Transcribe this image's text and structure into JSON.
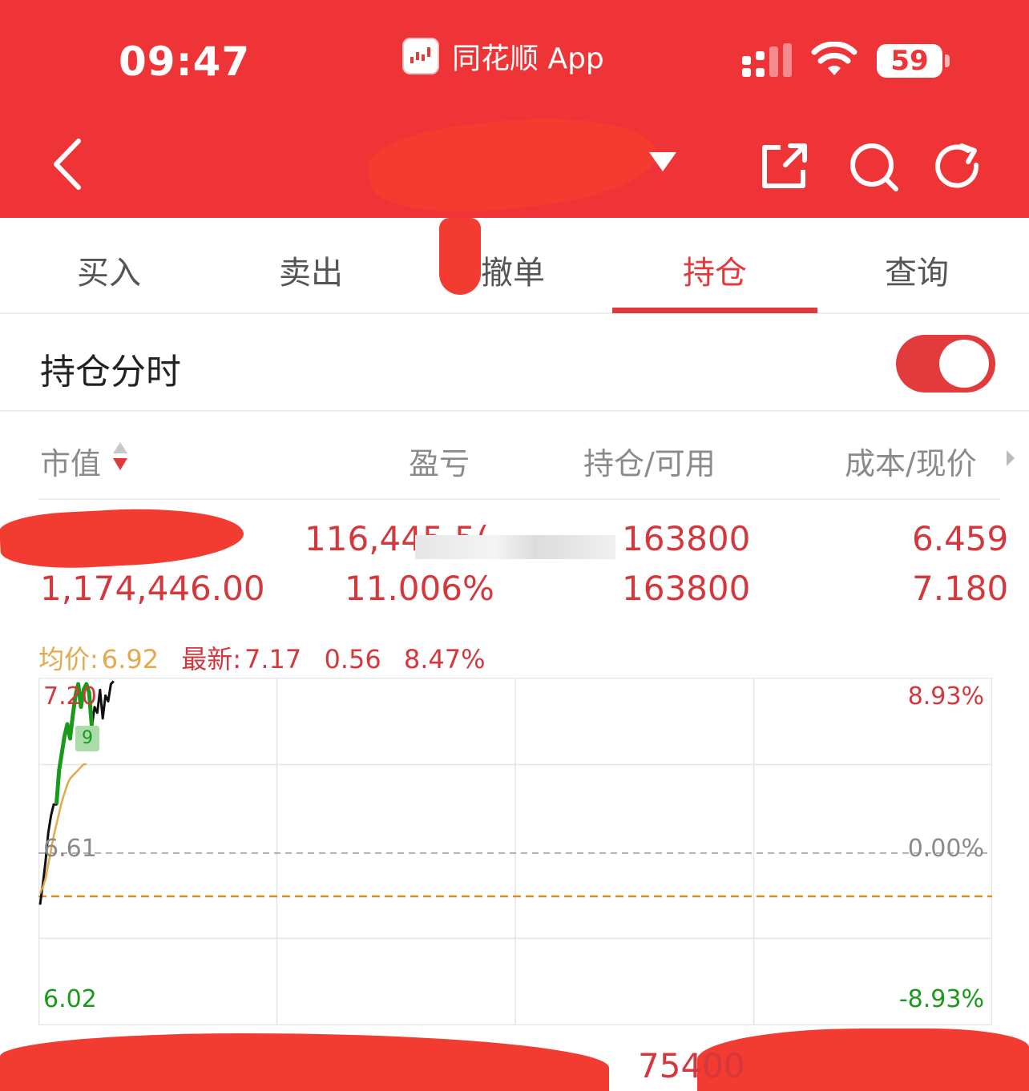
{
  "status_bar": {
    "time": "09:47",
    "app_name": "同花顺 App",
    "battery": "59"
  },
  "colors": {
    "brand_red": "#ee3437",
    "up_red": "#d5383c",
    "down_green": "#1a9a1a",
    "avg_orange": "#e3a94a",
    "muted_gray": "#8a8a8a"
  },
  "tabs": [
    {
      "label": "买入",
      "active": false
    },
    {
      "label": "卖出",
      "active": false
    },
    {
      "label": "撤单",
      "active": false
    },
    {
      "label": "持仓",
      "active": true
    },
    {
      "label": "查询",
      "active": false
    }
  ],
  "toggle": {
    "label": "持仓分时",
    "on": true
  },
  "columns": {
    "market_value": "市值",
    "pnl": "盈亏",
    "position": "持仓/可用",
    "cost_price": "成本/现价"
  },
  "holding": {
    "pnl_amount": "116,445.5(",
    "market_value": "1,174,446.00",
    "pnl_percent": "11.006%",
    "position": "163800",
    "available": "163800",
    "cost": "6.459",
    "price": "7.180"
  },
  "legend": {
    "avg_label": "均价:",
    "avg_value": "6.92",
    "latest_label": "最新:",
    "latest_value": "7.17",
    "change": "0.56",
    "change_pct": "8.47%"
  },
  "chart_data": {
    "type": "line",
    "y_labels_left": [
      "7.20",
      "6.61",
      "6.02"
    ],
    "y_labels_right": [
      "8.93%",
      "0.00%",
      "-8.93%"
    ],
    "ylim": [
      6.02,
      7.2
    ],
    "reference_price": 6.61,
    "cost_line": 6.459,
    "marker_label": "9",
    "series": [
      {
        "key": "price",
        "values": [
          6.43,
          6.5,
          6.58,
          6.68,
          6.74,
          6.78,
          6.78,
          6.9,
          6.96,
          7.02,
          7.06,
          7.01,
          7.09,
          7.16,
          7.2,
          7.12,
          7.18,
          7.2,
          7.17,
          7.05,
          7.12,
          7.1,
          7.18,
          7.08,
          7.16,
          7.14,
          7.2,
          7.21
        ]
      },
      {
        "key": "avg",
        "values": [
          6.47,
          6.49,
          6.52,
          6.57,
          6.62,
          6.67,
          6.71,
          6.75,
          6.79,
          6.82,
          6.85,
          6.87,
          6.88,
          6.89,
          6.9,
          6.91,
          6.92,
          6.92
        ]
      }
    ]
  },
  "bottom_row": {
    "value": "75400"
  }
}
